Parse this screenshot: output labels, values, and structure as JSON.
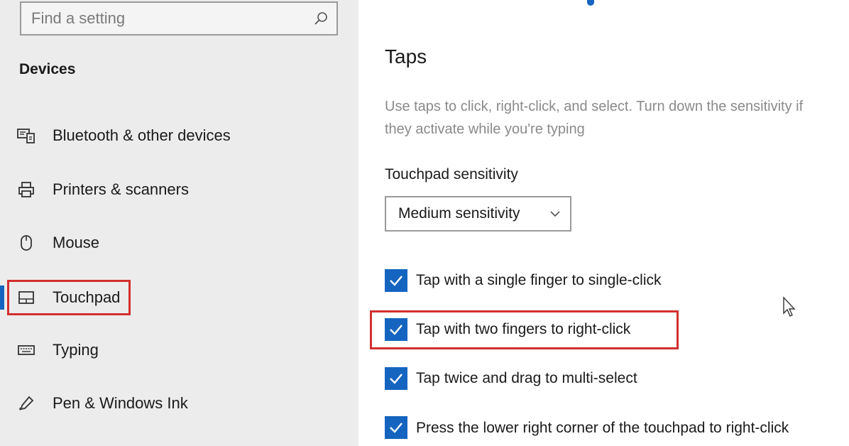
{
  "search": {
    "placeholder": "Find a setting",
    "icon": "search-icon"
  },
  "sidebar": {
    "heading": "Devices",
    "items": [
      {
        "label": "Bluetooth & other devices",
        "icon": "bluetooth-devices-icon"
      },
      {
        "label": "Printers & scanners",
        "icon": "printer-icon"
      },
      {
        "label": "Mouse",
        "icon": "mouse-icon"
      },
      {
        "label": "Touchpad",
        "icon": "touchpad-icon",
        "selected": true
      },
      {
        "label": "Typing",
        "icon": "keyboard-icon"
      },
      {
        "label": "Pen & Windows Ink",
        "icon": "pen-icon"
      }
    ]
  },
  "main": {
    "title": "Taps",
    "description": "Use taps to click, right-click, and select. Turn down the sensitivity if they activate while you're typing",
    "sensitivity": {
      "label": "Touchpad sensitivity",
      "value": "Medium sensitivity"
    },
    "options": [
      {
        "label": "Tap with a single finger to single-click",
        "checked": true
      },
      {
        "label": "Tap with two fingers to right-click",
        "checked": true,
        "highlighted": true
      },
      {
        "label": "Tap twice and drag to multi-select",
        "checked": true
      },
      {
        "label": "Press the lower right corner of the touchpad to right-click",
        "checked": true
      }
    ]
  },
  "colors": {
    "accent": "#1565c0",
    "highlight": "#d32f2f",
    "sidebar_bg": "#ececec"
  }
}
